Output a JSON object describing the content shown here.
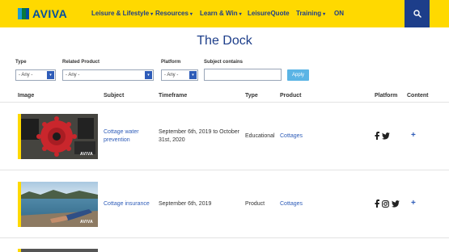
{
  "header": {
    "brand": "AVIVA",
    "nav": [
      {
        "label": "Leisure & Lifestyle",
        "caret": "▾"
      },
      {
        "label": "Resources",
        "caret": "▾"
      },
      {
        "label": "Learn & Win",
        "caret": "▾"
      },
      {
        "label": "LeisureQuote",
        "caret": ""
      },
      {
        "label": "Training",
        "caret": "▾"
      },
      {
        "label": "ON",
        "caret": ""
      }
    ],
    "search_icon": "search-icon"
  },
  "page_title": "The Dock",
  "filters": {
    "type": {
      "label": "Type",
      "value": "- Any -"
    },
    "related_product": {
      "label": "Related Product",
      "value": "- Any -"
    },
    "platform": {
      "label": "Platform",
      "value": "- Any -"
    },
    "subject": {
      "label": "Subject contains",
      "value": ""
    },
    "apply_label": "Apply"
  },
  "table": {
    "headers": [
      "Image",
      "Subject",
      "Timeframe",
      "Type",
      "Product",
      "Platform",
      "Content"
    ],
    "rows": [
      {
        "subject": "Cottage water prevention",
        "timeframe": "September 6th, 2019 to October 31st, 2020",
        "type": "Educational",
        "product": "Cottages",
        "platforms": [
          "facebook-icon",
          "twitter-icon"
        ],
        "content_action": "+",
        "image_brand": "AVIVA"
      },
      {
        "subject": "Cottage insurance",
        "timeframe": "September 6th, 2019",
        "type": "Product",
        "product": "Cottages",
        "platforms": [
          "facebook-icon",
          "instagram-icon",
          "twitter-icon"
        ],
        "content_action": "+",
        "image_brand": "AVIVA"
      }
    ]
  },
  "colors": {
    "header_bg": "#ffd900",
    "brand_blue": "#1d3e8a",
    "link": "#2e5cb8",
    "apply": "#5ab4e5"
  }
}
